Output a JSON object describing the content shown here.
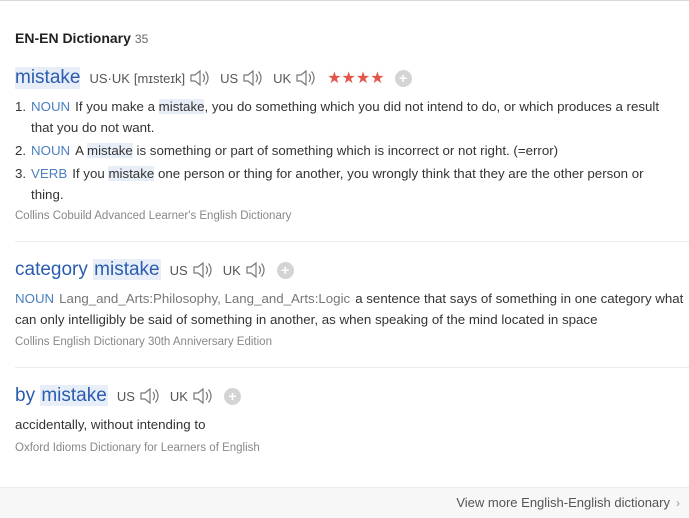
{
  "header": {
    "title": "EN-EN Dictionary",
    "count": "35"
  },
  "entries": [
    {
      "headword": "mistake",
      "phonetics": [
        {
          "label": "US·UK",
          "ipa": "[mɪsteɪk]"
        },
        {
          "label": "US"
        },
        {
          "label": "UK"
        }
      ],
      "stars": "★★★★",
      "senses": [
        {
          "num": "1.",
          "pos": "NOUN",
          "before": "If you make a ",
          "hl": "mistake",
          "after": ", you do something which you did not intend to do, or which produces a result that you do not want."
        },
        {
          "num": "2.",
          "pos": "NOUN",
          "before": "A ",
          "hl": "mistake",
          "after": " is something or part of something which is incorrect or not right. (=error)"
        },
        {
          "num": "3.",
          "pos": "VERB",
          "before": "If you ",
          "hl": "mistake",
          "after": " one person or thing for another, you wrongly think that they are the other person or thing."
        }
      ],
      "source": "Collins Cobuild Advanced Learner's English Dictionary"
    },
    {
      "headword_pre": "category ",
      "headword_hl": "mistake",
      "phonetics": [
        {
          "label": "US"
        },
        {
          "label": "UK"
        }
      ],
      "pos": "NOUN",
      "domain": "Lang_and_Arts:Philosophy, Lang_and_Arts:Logic",
      "definition": "a sentence that says of something in one category what can only intelligibly be said of something in another, as when speaking of the mind located in space",
      "source": "Collins English Dictionary 30th Anniversary Edition"
    },
    {
      "headword_pre": "by ",
      "headword_hl": "mistake",
      "phonetics": [
        {
          "label": "US"
        },
        {
          "label": "UK"
        }
      ],
      "definition": "accidentally, without intending to",
      "source": "Oxford Idioms Dictionary for Learners of English"
    }
  ],
  "footer": {
    "more": "View more English-English dictionary",
    "chevron": "›"
  },
  "colors": {
    "headword": "#2a5db0",
    "pos": "#4a7fc0",
    "stars": "#e2574c",
    "highlight": "#e8eef8"
  },
  "icons": [
    "speaker-icon",
    "plus-icon",
    "star-icon",
    "chevron-right-icon"
  ]
}
